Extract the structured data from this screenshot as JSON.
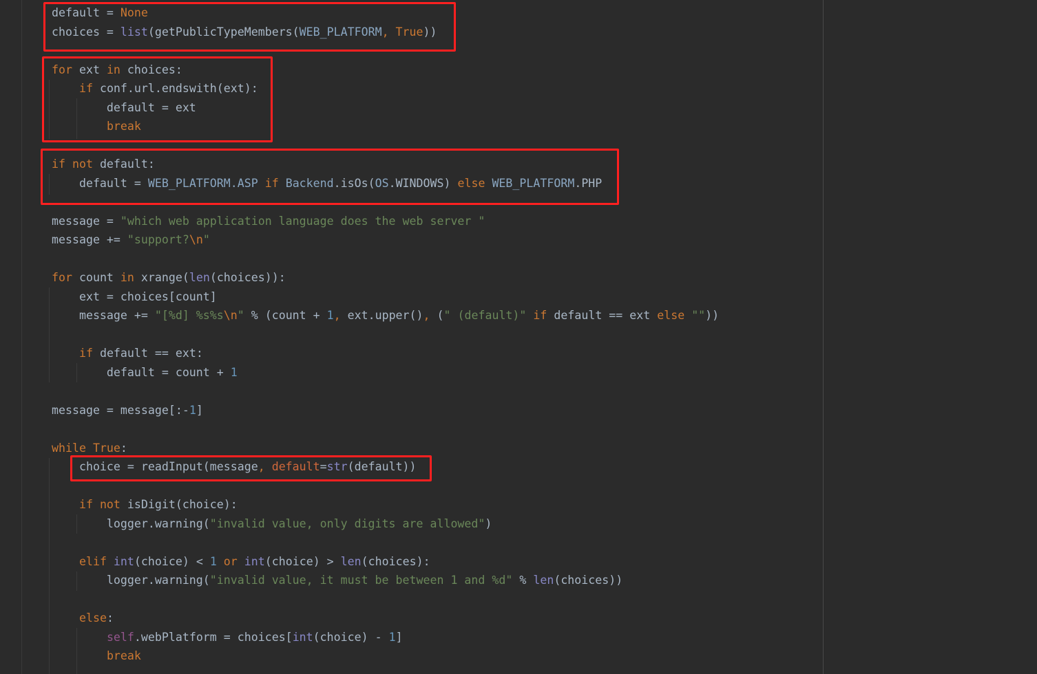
{
  "editor": {
    "theme_colors": {
      "background": "#2b2b2b",
      "text": "#a9b7c6",
      "keyword": "#cc7832",
      "string": "#6a8759",
      "number": "#6897bb",
      "builtin": "#8888c6",
      "highlight_box": "#ff2020"
    },
    "lines": [
      [
        [
          "",
          "default = "
        ],
        [
          "kw",
          "None"
        ]
      ],
      [
        [
          "",
          "choices = "
        ],
        [
          "bi",
          "list"
        ],
        [
          "",
          "(getPublicTypeMembers("
        ],
        [
          "cls",
          "WEB_PLATFORM"
        ],
        [
          "kw",
          ", True"
        ],
        [
          "",
          "))"
        ]
      ],
      [],
      [
        [
          "kw",
          "for "
        ],
        [
          "",
          "ext "
        ],
        [
          "kw",
          "in "
        ],
        [
          "",
          "choices:"
        ]
      ],
      [
        [
          "",
          "    "
        ],
        [
          "kw",
          "if "
        ],
        [
          "",
          "conf.url.endswith(ext):"
        ]
      ],
      [
        [
          "",
          "        default = ext"
        ]
      ],
      [
        [
          "",
          "        "
        ],
        [
          "kw",
          "break"
        ]
      ],
      [],
      [
        [
          "kw",
          "if not "
        ],
        [
          "",
          "default:"
        ]
      ],
      [
        [
          "",
          "    default = "
        ],
        [
          "cls",
          "WEB_PLATFORM.ASP "
        ],
        [
          "kw",
          "if "
        ],
        [
          "cls",
          "Backend"
        ],
        [
          ".",
          ".isOs("
        ],
        [
          "cls",
          "OS"
        ],
        [
          "",
          ".WINDOWS) "
        ],
        [
          "kw",
          "else "
        ],
        [
          "cls",
          "WEB_PLATFORM"
        ],
        [
          "",
          ".PHP"
        ]
      ],
      [],
      [
        [
          "",
          "message = "
        ],
        [
          "str",
          "\"which web application language does the web server \""
        ]
      ],
      [
        [
          "",
          "message += "
        ],
        [
          "str",
          "\"support?"
        ],
        [
          "esc",
          "\\n"
        ],
        [
          "str",
          "\""
        ]
      ],
      [],
      [
        [
          "kw",
          "for "
        ],
        [
          "",
          "count "
        ],
        [
          "kw",
          "in "
        ],
        [
          "",
          "xrange("
        ],
        [
          "bi",
          "len"
        ],
        [
          "",
          "(choices)):"
        ]
      ],
      [
        [
          "",
          "    ext = choices[count]"
        ]
      ],
      [
        [
          "",
          "    message += "
        ],
        [
          "str",
          "\"[%d] %s%s"
        ],
        [
          "esc",
          "\\n"
        ],
        [
          "str",
          "\""
        ],
        [
          "",
          " % (count + "
        ],
        [
          "num",
          "1"
        ],
        [
          "kw",
          ", "
        ],
        [
          "",
          "ext.upper()"
        ],
        [
          "kw",
          ", "
        ],
        [
          "",
          "("
        ],
        [
          "str",
          "\" (default)\" "
        ],
        [
          "kw",
          "if "
        ],
        [
          "",
          "default == ext "
        ],
        [
          "kw",
          "else "
        ],
        [
          "str",
          "\"\""
        ],
        [
          "",
          "))"
        ]
      ],
      [],
      [
        [
          "",
          "    "
        ],
        [
          "kw",
          "if "
        ],
        [
          "",
          "default == ext:"
        ]
      ],
      [
        [
          "",
          "        default = count + "
        ],
        [
          "num",
          "1"
        ]
      ],
      [],
      [
        [
          "",
          "message = message[:-"
        ],
        [
          "num",
          "1"
        ],
        [
          "",
          "]"
        ]
      ],
      [],
      [
        [
          "kw",
          "while True"
        ],
        [
          "",
          ":"
        ]
      ],
      [
        [
          "",
          "    choice = readInput(message"
        ],
        [
          "kw",
          ", "
        ],
        [
          "param",
          "default"
        ],
        [
          "",
          "="
        ],
        [
          "bi",
          "str"
        ],
        [
          "",
          "(default))"
        ]
      ],
      [],
      [
        [
          "",
          "    "
        ],
        [
          "kw",
          "if not "
        ],
        [
          "",
          "isDigit(choice):"
        ]
      ],
      [
        [
          "",
          "        logger.warning("
        ],
        [
          "str",
          "\"invalid value, only digits are allowed\""
        ],
        [
          "",
          ")"
        ]
      ],
      [],
      [
        [
          "",
          "    "
        ],
        [
          "kw",
          "elif "
        ],
        [
          "bi",
          "int"
        ],
        [
          "",
          "(choice) < "
        ],
        [
          "num",
          "1 "
        ],
        [
          "kw",
          "or "
        ],
        [
          "bi",
          "int"
        ],
        [
          "",
          "(choice) > "
        ],
        [
          "bi",
          "len"
        ],
        [
          "",
          "(choices):"
        ]
      ],
      [
        [
          "",
          "        logger.warning("
        ],
        [
          "str",
          "\"invalid value, it must be between 1 and %d\""
        ],
        [
          "",
          " % "
        ],
        [
          "bi",
          "len"
        ],
        [
          "",
          "(choices))"
        ]
      ],
      [],
      [
        [
          "",
          "    "
        ],
        [
          "kw",
          "else"
        ],
        [
          "",
          ":"
        ]
      ],
      [
        [
          "",
          "        "
        ],
        [
          "self",
          "self"
        ],
        [
          "",
          ".webPlatform = choices["
        ],
        [
          "bi",
          "int"
        ],
        [
          "",
          "(choice) - "
        ],
        [
          "num",
          "1"
        ],
        [
          "",
          "]"
        ]
      ],
      [
        [
          "",
          "        "
        ],
        [
          "kw",
          "break"
        ]
      ]
    ]
  }
}
